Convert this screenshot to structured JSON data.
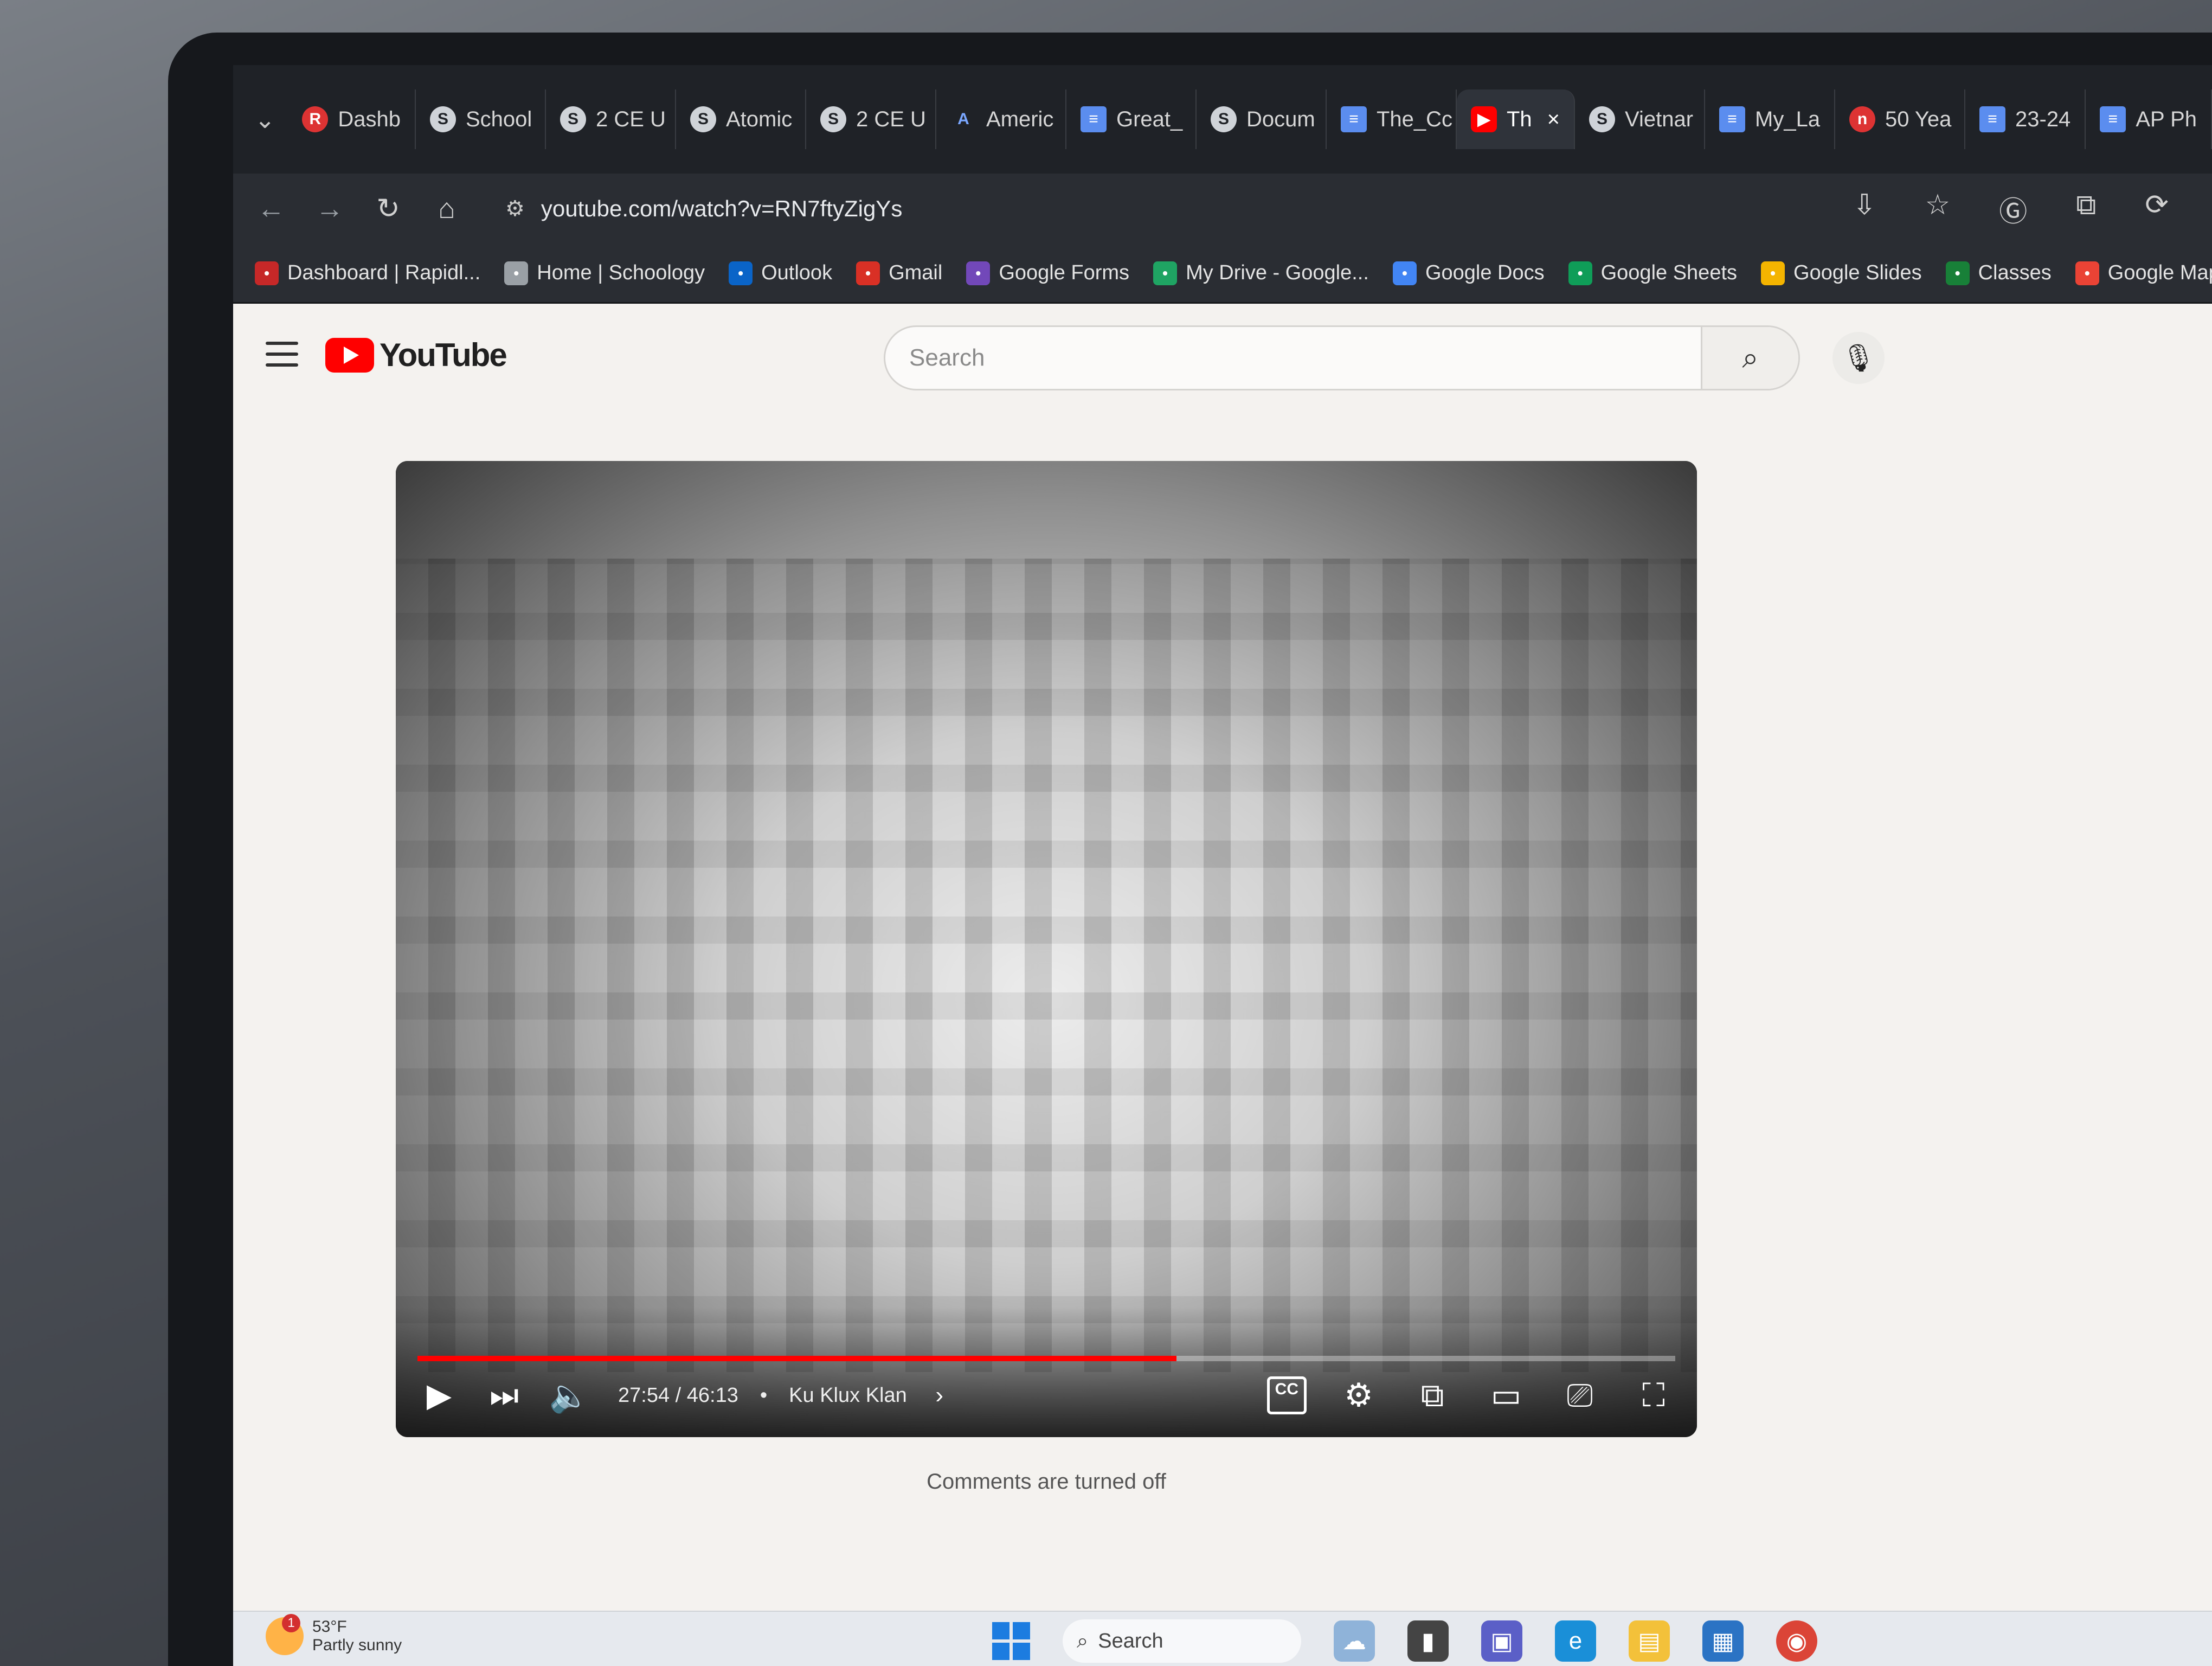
{
  "browser": {
    "tabs": [
      {
        "label": "Dashb",
        "icon": "rapid-identity-icon",
        "style": "red"
      },
      {
        "label": "School",
        "icon": "schoology-icon",
        "style": "s"
      },
      {
        "label": "2 CE U",
        "icon": "schoology-icon",
        "style": "s"
      },
      {
        "label": "Atomic",
        "icon": "schoology-icon",
        "style": "s"
      },
      {
        "label": "2 CE U",
        "icon": "schoology-icon",
        "style": "s"
      },
      {
        "label": "Americ",
        "icon": "a-icon",
        "style": "amer"
      },
      {
        "label": "Great_",
        "icon": "google-docs-icon",
        "style": "doc"
      },
      {
        "label": "Docum",
        "icon": "schoology-icon",
        "style": "s"
      },
      {
        "label": "The_Cc",
        "icon": "google-docs-icon",
        "style": "doc"
      },
      {
        "label": "Th",
        "icon": "youtube-icon",
        "style": "yt",
        "active": true
      },
      {
        "label": "Vietnar",
        "icon": "schoology-icon",
        "style": "s"
      },
      {
        "label": "My_La",
        "icon": "google-docs-icon",
        "style": "doc"
      },
      {
        "label": "50 Yea",
        "icon": "npr-icon",
        "style": "red"
      },
      {
        "label": "23-24",
        "icon": "google-docs-icon",
        "style": "doc"
      },
      {
        "label": "AP Ph",
        "icon": "google-docs-icon",
        "style": "doc"
      }
    ],
    "address": "youtube.com/watch?v=RN7ftyZigYs",
    "bookmarks": [
      {
        "label": "Dashboard | Rapidl...",
        "icon": "rapid-identity-icon",
        "color": "#c62828"
      },
      {
        "label": "Home | Schoology",
        "icon": "schoology-icon",
        "color": "#9aa0a6"
      },
      {
        "label": "Outlook",
        "icon": "outlook-icon",
        "color": "#0a64c8"
      },
      {
        "label": "Gmail",
        "icon": "gmail-icon",
        "color": "#d93025"
      },
      {
        "label": "Google Forms",
        "icon": "google-forms-icon",
        "color": "#7248b9"
      },
      {
        "label": "My Drive - Google...",
        "icon": "google-drive-icon",
        "color": "#1fa463"
      },
      {
        "label": "Google Docs",
        "icon": "google-docs-icon",
        "color": "#4285f4"
      },
      {
        "label": "Google Sheets",
        "icon": "google-sheets-icon",
        "color": "#0f9d58"
      },
      {
        "label": "Google Slides",
        "icon": "google-slides-icon",
        "color": "#f4b400"
      },
      {
        "label": "Classes",
        "icon": "google-classroom-icon",
        "color": "#188038"
      },
      {
        "label": "Google Maps",
        "icon": "google-maps-icon",
        "color": "#ea4335"
      }
    ]
  },
  "youtube": {
    "logo_text": "YouTube",
    "search_placeholder": "Search",
    "player": {
      "time": "27:54 / 46:13",
      "separator": "•",
      "chapter": "Ku Klux Klan",
      "progress": 0.6035
    },
    "comments_status": "Comments are turned off"
  },
  "taskbar": {
    "weather_temp": "53°F",
    "weather_desc": "Partly sunny",
    "weather_badge": "1",
    "search_label": "Search"
  },
  "colors": {
    "youtube_red": "#ff0000",
    "browser_dark": "#1f2227",
    "page_bg": "#f4f2ef"
  }
}
